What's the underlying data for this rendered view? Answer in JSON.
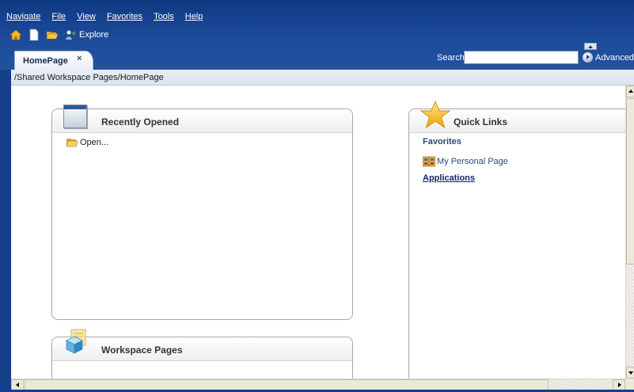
{
  "menubar": {
    "items": [
      {
        "label": "Navigate"
      },
      {
        "label": "File"
      },
      {
        "label": "View"
      },
      {
        "label": "Favorites"
      },
      {
        "label": "Tools"
      },
      {
        "label": "Help"
      }
    ]
  },
  "toolbar": {
    "icons": [
      "home-icon",
      "new-document-icon",
      "open-folder-icon",
      "explore-icon"
    ],
    "explore_label": "Explore"
  },
  "tabs": [
    {
      "label": "HomePage",
      "close_glyph": "×",
      "active": true
    }
  ],
  "search": {
    "label": "Search",
    "value": "",
    "advanced_label": "Advanced"
  },
  "breadcrumb": "/Shared Workspace Pages/HomePage",
  "panels": {
    "recently_opened": {
      "title": "Recently Opened",
      "icon": "window-icon",
      "items": [
        {
          "label": "Open...",
          "icon": "open-folder-icon"
        }
      ]
    },
    "workspace_pages": {
      "title": "Workspace Pages",
      "icon": "workspace-cube-icon"
    },
    "quick_links": {
      "title": "Quick Links",
      "icon": "star-icon",
      "favorites_heading": "Favorites",
      "favorites": [
        {
          "label": "My Personal Page",
          "icon": "personal-page-icon"
        }
      ],
      "applications_label": "Applications"
    }
  },
  "colors": {
    "header_blue": "#14408a",
    "link_blue": "#14246e",
    "panel_border": "#a6a6a6"
  }
}
